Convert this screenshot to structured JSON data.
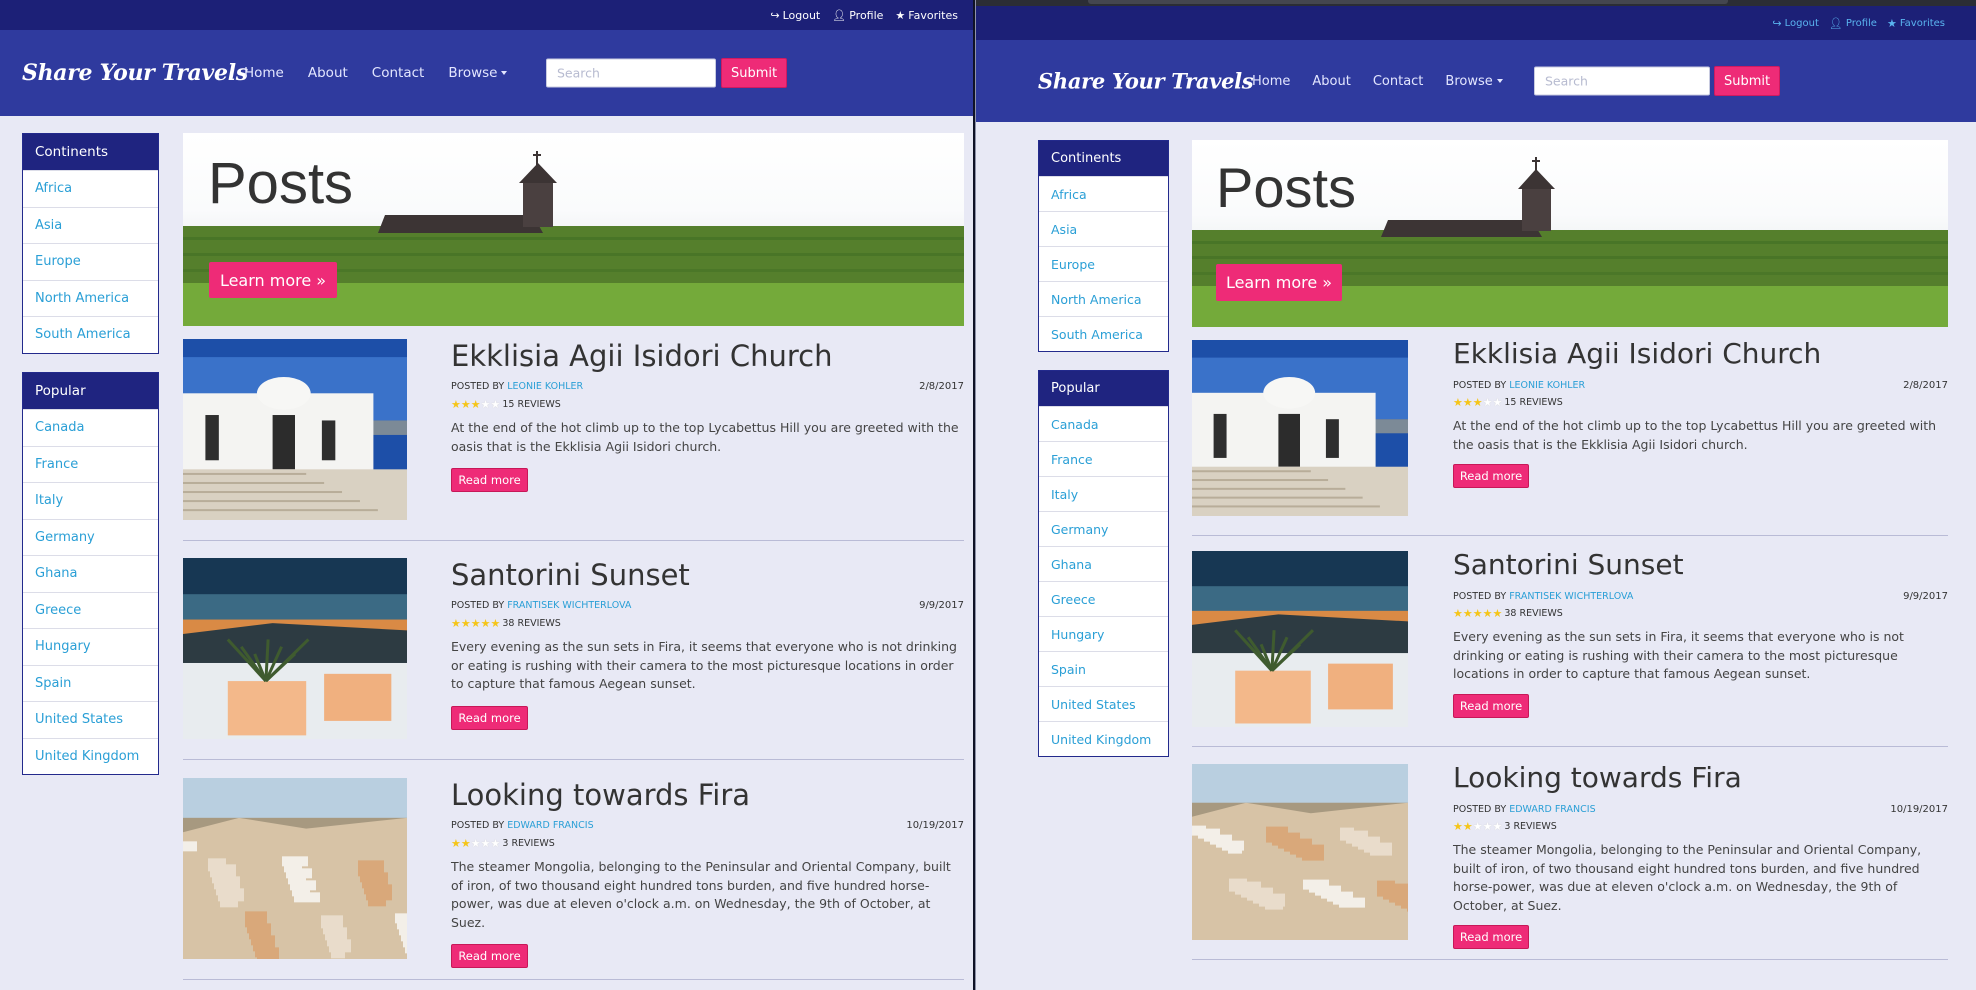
{
  "topbar": {
    "logout": "Logout",
    "profile": "Profile",
    "favorites": "Favorites"
  },
  "navbar": {
    "brand": "Share Your Travels",
    "links": [
      "Home",
      "About",
      "Contact",
      "Browse"
    ],
    "search_placeholder": "Search",
    "submit": "Submit"
  },
  "sidebar": {
    "continents": {
      "title": "Continents",
      "items": [
        "Africa",
        "Asia",
        "Europe",
        "North America",
        "South America"
      ]
    },
    "popular": {
      "title": "Popular",
      "items": [
        "Canada",
        "France",
        "Italy",
        "Germany",
        "Ghana",
        "Greece",
        "Hungary",
        "Spain",
        "United States",
        "United Kingdom"
      ]
    }
  },
  "hero": {
    "title": "Posts",
    "button": "Learn more »"
  },
  "posts": [
    {
      "title": "Ekklisia Agii Isidori Church",
      "posted_by": "POSTED BY",
      "author": "LEONIE KOHLER",
      "date": "2/8/2017",
      "rating": 3,
      "reviews": "15 REVIEWS",
      "excerpt": "At the end of the hot climb up to the top Lycabettus Hill you are greeted with the oasis that is the Ekklisia Agii Isidori church.",
      "button": "Read more"
    },
    {
      "title": "Santorini Sunset",
      "posted_by": "POSTED BY",
      "author": "FRANTISEK WICHTERLOVA",
      "date": "9/9/2017",
      "rating": 5,
      "reviews": "38 REVIEWS",
      "excerpt": "Every evening as the sun sets in Fira, it seems that everyone who is not drinking or eating is rushing with their camera to the most picturesque locations in order to capture that famous Aegean sunset.",
      "button": "Read more"
    },
    {
      "title": "Looking towards Fira",
      "posted_by": "POSTED BY",
      "author": "EDWARD FRANCIS",
      "date": "10/19/2017",
      "rating": 2,
      "reviews": "3 REVIEWS",
      "excerpt": "The steamer Mongolia, belonging to the Peninsular and Oriental Company, built of iron, of two thousand eight hundred tons burden, and five hundred horse-power, was due at eleven o'clock a.m. on Wednesday, the 9th of October, at Suez.",
      "button": "Read more"
    }
  ],
  "colors": {
    "topbar": "#1c2077",
    "navbar": "#2f3a9e",
    "accent": "#ee2b77",
    "link": "#2a9fd6",
    "background": "#e8e9f5"
  },
  "icons": {
    "logout": "logout-icon",
    "profile": "user-icon",
    "favorites": "star-icon"
  }
}
